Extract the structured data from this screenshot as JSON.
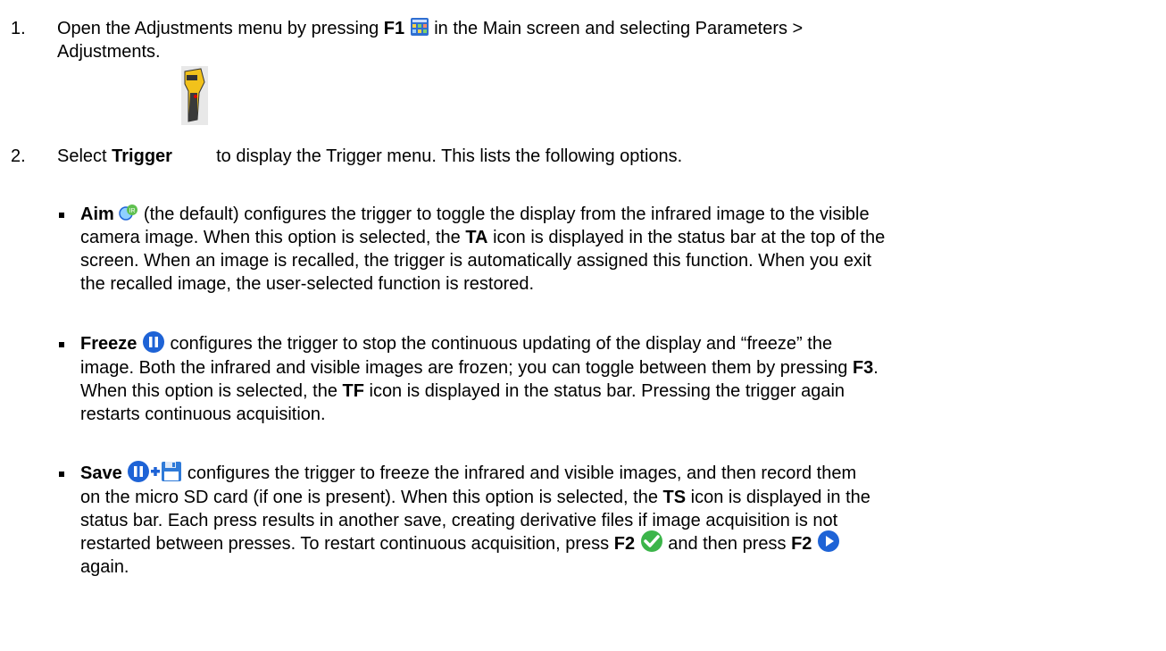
{
  "step1": {
    "number": "1.",
    "text_a": "Open the Adjustments menu by pressing ",
    "key": "F1",
    "text_b": " in the Main screen and selecting Parameters >",
    "text_c": "Adjustments."
  },
  "step2": {
    "number": "2.",
    "text_a": "Select ",
    "label": "Trigger",
    "text_b": " to display the Trigger menu. This lists the following options."
  },
  "options": {
    "aim": {
      "label": "Aim",
      "line1": " (the default) configures the trigger to toggle the display from the infrared image to the visible",
      "line2a": "camera image. When this option is selected, the ",
      "line2_icon": "TA",
      "line2b": " icon is displayed in the status bar at the top of the",
      "line3": "screen. When an image is recalled, the trigger is automatically assigned this function. When you exit",
      "line4": "the recalled image, the user-selected function is restored."
    },
    "freeze": {
      "label": "Freeze",
      "line1": " configures the trigger to stop the continuous updating of the display and “freeze” the",
      "line2a": "image. Both the infrared and visible images are frozen; you can toggle between them by pressing ",
      "line2_key": "F3",
      "line2b": ".",
      "line3a": "When this option is selected, the ",
      "line3_icon": "TF",
      "line3b": " icon is displayed in the status bar. Pressing the trigger again",
      "line4": "restarts continuous acquisition."
    },
    "save": {
      "label": "Save",
      "line1": " configures the trigger to freeze the infrared and visible images, and then record them",
      "line2a": "on the micro SD card (if one is present). When this option is selected, the ",
      "line2_icon": "TS",
      "line2b": " icon is displayed in the",
      "line3": "status bar. Each press results in another save, creating derivative files if image acquisition is not",
      "line4a": "restarted between presses. To restart continuous acquisition, press ",
      "line4_key1": "F2",
      "line4b": " and then press ",
      "line4_key2": "F2",
      "line5": "again."
    }
  },
  "icons": {
    "menu": "grid-menu-icon",
    "trigger": "camera-trigger-icon",
    "aim": "aim-ir-icon",
    "freeze": "pause-icon",
    "save_floppy": "floppy-disk-icon",
    "confirm": "check-icon",
    "play": "play-icon"
  },
  "colors": {
    "icon_blue": "#1e63d6",
    "check_green": "#3cb54a",
    "trigger_yellow": "#f2c21b"
  }
}
